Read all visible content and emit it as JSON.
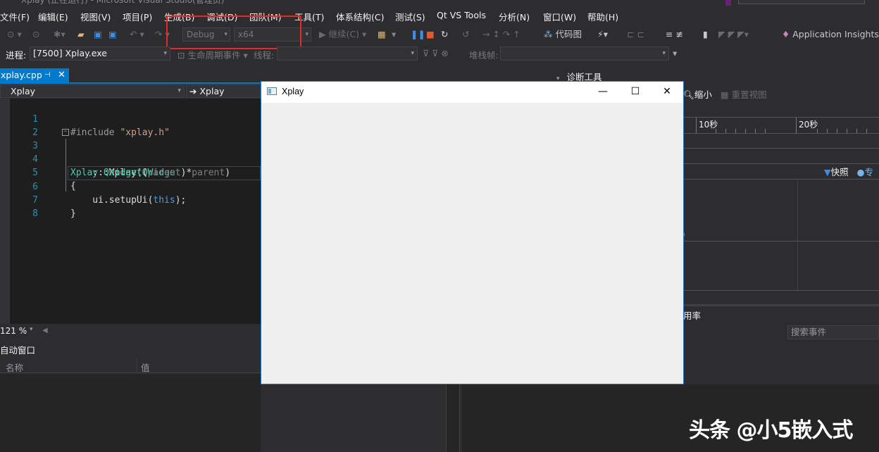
{
  "window": {
    "title": "Xplay (正在运行) - Microsoft Visual Studio(管理员)"
  },
  "menu": [
    "文件(F)",
    "编辑(E)",
    "视图(V)",
    "项目(P)",
    "生成(B)",
    "调试(D)",
    "团队(M)",
    "工具(T)",
    "体系结构(C)",
    "测试(S)",
    "Qt VS Tools",
    "分析(N)",
    "窗口(W)",
    "帮助(H)"
  ],
  "toolbar": {
    "config": "Debug",
    "platform": "x64",
    "continue_label": "继续(C)",
    "codemap_label": "代码图",
    "insights_label": "Application Insights"
  },
  "process_bar": {
    "process_label": "进程:",
    "process_value": "[7500] Xplay.exe",
    "lifecycle_label": "生命周期事件",
    "thread_label": "线程:",
    "stackframe_label": "堆栈帧:"
  },
  "editor": {
    "tab_name": "xplay.cpp",
    "nav_left": "Xplay",
    "nav_right": "Xplay",
    "line_numbers": [
      "1",
      "2",
      "3",
      "4",
      "5",
      "6",
      "7",
      "8"
    ],
    "zoom": "121 %"
  },
  "autos": {
    "title": "自动窗口",
    "col_name": "名称",
    "col_value": "值"
  },
  "diagnostics": {
    "title": "诊断工具",
    "shrink_label": "缩小",
    "reset_label": "重置视图",
    "ruler_10": "10秒",
    "ruler_20": "20秒",
    "snapshot_label": "快照",
    "private_label": "专",
    "usage_tab": "用率",
    "search_events": "搜索事件",
    "paren": ")"
  },
  "qt_window": {
    "title": "Xplay",
    "min_glyph": "—",
    "max_glyph": "☐",
    "close_glyph": "✕"
  },
  "watermark": "头条 @小5嵌入式",
  "colors": {
    "accent": "#007acc",
    "highlight_box": "#e8292b",
    "background": "#2d2d30"
  }
}
